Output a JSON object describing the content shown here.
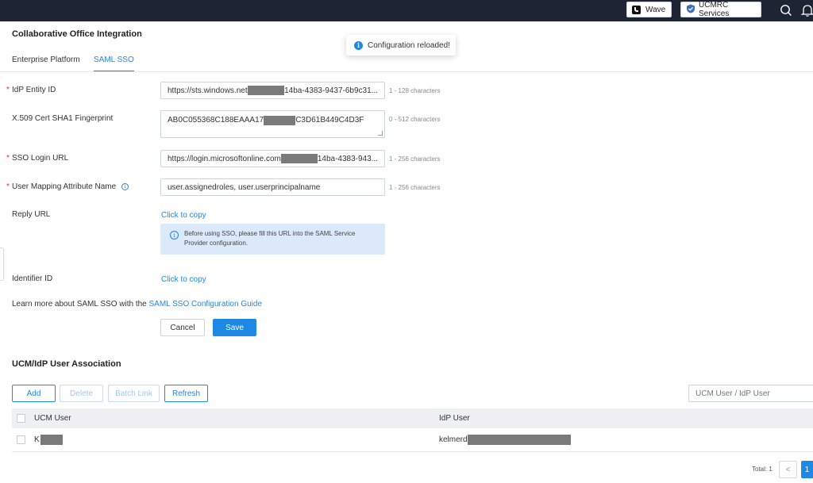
{
  "topbar": {
    "wave_label": "Wave",
    "services_label": "UCMRC Services"
  },
  "page": {
    "title": "Collaborative Office Integration",
    "tabs": [
      {
        "label": "Enterprise Platform",
        "active": false
      },
      {
        "label": "SAML SSO",
        "active": true
      }
    ]
  },
  "toast": {
    "message": "Configuration reloaded!"
  },
  "form": {
    "idp_entity_id": {
      "label": "IdP Entity ID",
      "value_prefix": "https://sts.windows.net",
      "value_suffix": "14ba-4383-9437-6b9c31...",
      "hint": "1 - 128 characters"
    },
    "cert_fingerprint": {
      "label": "X.509 Cert SHA1 Fingerprint",
      "value_prefix": "AB0C055368C188EAAA17",
      "value_suffix": "C3D61B449C4D3F",
      "hint": "0 - 512 characters"
    },
    "sso_login_url": {
      "label": "SSO Login URL",
      "value_prefix": "https://login.microsoftonline.com",
      "value_suffix": "14ba-4383-943...",
      "hint": "1 - 256 characters"
    },
    "user_mapping": {
      "label": "User Mapping Attribute Name",
      "value": "user.assignedroles, user.userprincipalname",
      "hint": "1 - 256 characters"
    },
    "reply_url": {
      "label": "Reply URL",
      "link": "Click to copy",
      "notice": "Before using SSO, please fill this URL into the SAML Service Provider configuration."
    },
    "identifier_id": {
      "label": "Identifier ID",
      "link": "Click to copy"
    },
    "learn_more_text": "Learn more about SAML SSO with the",
    "learn_more_link": "SAML SSO Configuration Guide",
    "cancel_label": "Cancel",
    "save_label": "Save"
  },
  "association": {
    "title": "UCM/IdP User Association",
    "add_label": "Add",
    "delete_label": "Delete",
    "batch_link_label": "Batch Link",
    "refresh_label": "Refresh",
    "search_placeholder": "UCM User / IdP User",
    "columns": [
      "UCM User",
      "IdP User"
    ],
    "rows": [
      {
        "ucm_user": "K",
        "idp_user": "kelmerd"
      }
    ],
    "pager": {
      "total_text": "Total: 1",
      "prev_label": "<",
      "current_page": "1"
    }
  },
  "colors": {
    "accent": "#1e88e5",
    "topbar": "#1d2535",
    "required": "#e53935"
  }
}
